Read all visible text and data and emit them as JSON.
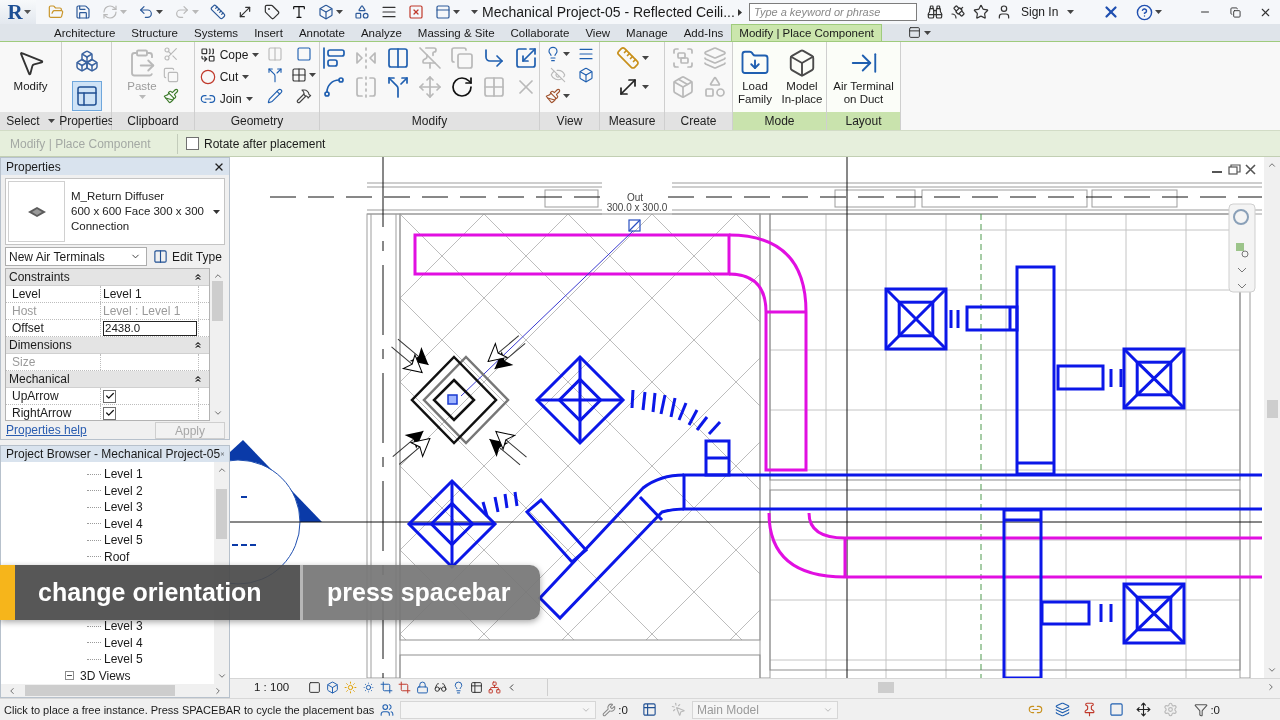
{
  "title_bar": {
    "app_logo": "R",
    "title": "Mechanical Project-05 - Reflected Ceili...",
    "search": {
      "placeholder": "Type a keyword or phrase"
    },
    "sign_in": "Sign In"
  },
  "quick_access": [
    {
      "disabled": false
    },
    {
      "disabled": false
    },
    {
      "disabled": true
    },
    {
      "disabled": false
    },
    {
      "disabled": true
    },
    {
      "disabled": false
    },
    {
      "disabled": false
    },
    {
      "disabled": false
    },
    {
      "disabled": false
    },
    {
      "disabled": false
    },
    {
      "disabled": false
    },
    {
      "disabled": false
    },
    {
      "disabled": false
    },
    {
      "disabled": false
    }
  ],
  "ribbon_tabs": [
    {
      "label": "Architecture",
      "selected": false
    },
    {
      "label": "Structure",
      "selected": false
    },
    {
      "label": "Systems",
      "selected": false
    },
    {
      "label": "Insert",
      "selected": false
    },
    {
      "label": "Annotate",
      "selected": false
    },
    {
      "label": "Analyze",
      "selected": false
    },
    {
      "label": "Massing & Site",
      "selected": false
    },
    {
      "label": "Collaborate",
      "selected": false
    },
    {
      "label": "View",
      "selected": false
    },
    {
      "label": "Manage",
      "selected": false
    },
    {
      "label": "Add-Ins",
      "selected": false
    },
    {
      "label": "Modify | Place Component",
      "selected": true
    }
  ],
  "ribbon_panels": [
    {
      "title": "Select",
      "has_menu": true,
      "contextual": false,
      "tools": [
        {
          "kind": "large",
          "label": "Modify",
          "disabled": false
        }
      ]
    },
    {
      "title": "Properties",
      "has_menu": false,
      "contextual": false,
      "tools": [
        {
          "kind": "icon",
          "disabled": false,
          "selected": false
        },
        {
          "kind": "icon",
          "disabled": false,
          "selected": true
        }
      ]
    },
    {
      "title": "Clipboard",
      "has_menu": false,
      "contextual": false,
      "tools": [
        {
          "kind": "large",
          "label": "Paste",
          "disabled": true,
          "menu": true
        },
        {
          "kind": "icon",
          "disabled": true
        },
        {
          "kind": "icon",
          "disabled": true
        },
        {
          "kind": "icon",
          "disabled": false
        }
      ]
    },
    {
      "title": "Geometry",
      "has_menu": false,
      "contextual": false,
      "tools": [
        {
          "kind": "small",
          "label": "Cope",
          "disabled": false,
          "menu": true
        },
        {
          "kind": "small",
          "label": "Cut",
          "disabled": false,
          "menu": true
        },
        {
          "kind": "small",
          "label": "Join",
          "disabled": false,
          "menu": true
        },
        {
          "kind": "icon",
          "disabled": true
        },
        {
          "kind": "icon",
          "disabled": false
        },
        {
          "kind": "icon",
          "disabled": false
        },
        {
          "kind": "icon",
          "disabled": false
        },
        {
          "kind": "icon",
          "disabled": false,
          "menu": true
        },
        {
          "kind": "icon",
          "disabled": false
        }
      ]
    },
    {
      "title": "Modify",
      "has_menu": false,
      "contextual": false,
      "tools": [
        {
          "kind": "icon",
          "disabled": false
        },
        {
          "kind": "icon",
          "disabled": false
        },
        {
          "kind": "icon",
          "disabled": true
        },
        {
          "kind": "icon",
          "disabled": true
        },
        {
          "kind": "icon",
          "disabled": false
        },
        {
          "kind": "icon",
          "disabled": false
        },
        {
          "kind": "icon",
          "disabled": true
        },
        {
          "kind": "icon",
          "disabled": true
        },
        {
          "kind": "icon",
          "disabled": true
        },
        {
          "kind": "icon",
          "disabled": false
        },
        {
          "kind": "icon",
          "disabled": false
        },
        {
          "kind": "icon",
          "disabled": true
        },
        {
          "kind": "icon",
          "disabled": false
        },
        {
          "kind": "icon",
          "disabled": true
        }
      ]
    },
    {
      "title": "View",
      "has_menu": false,
      "contextual": false,
      "tools": [
        {
          "kind": "icon",
          "disabled": false,
          "menu": true
        },
        {
          "kind": "icon",
          "disabled": true
        },
        {
          "kind": "icon",
          "disabled": false,
          "menu": true
        },
        {
          "kind": "icon",
          "disabled": false
        },
        {
          "kind": "icon",
          "disabled": false
        }
      ]
    },
    {
      "title": "Measure",
      "has_menu": false,
      "contextual": false,
      "tools": [
        {
          "kind": "icon",
          "disabled": false,
          "menu": true
        },
        {
          "kind": "icon",
          "disabled": false,
          "menu": true
        }
      ]
    },
    {
      "title": "Create",
      "has_menu": false,
      "contextual": false,
      "tools": [
        {
          "kind": "icon",
          "disabled": true
        },
        {
          "kind": "icon",
          "disabled": true
        },
        {
          "kind": "icon",
          "disabled": true
        },
        {
          "kind": "icon",
          "disabled": true
        }
      ]
    },
    {
      "title": "Mode",
      "has_menu": false,
      "contextual": true,
      "tools": [
        {
          "kind": "large",
          "label": "Load Family",
          "disabled": false
        },
        {
          "kind": "large",
          "label": "Model In-place",
          "disabled": false
        }
      ]
    },
    {
      "title": "Layout",
      "has_menu": false,
      "contextual": true,
      "tools": [
        {
          "kind": "large",
          "label": "Air Terminal on Duct",
          "disabled": false
        }
      ]
    }
  ],
  "options_bar": {
    "context": "Modify | Place Component",
    "rotate_after_placement": {
      "label": "Rotate after placement",
      "checked": false
    }
  },
  "properties": {
    "title": "Properties",
    "type": {
      "family": "M_Return Diffuser",
      "type_name": "600 x 600 Face 300 x 300 Connection"
    },
    "instance_filter": "New Air Terminals",
    "edit_type": "Edit Type",
    "groups": [
      {
        "label": "Constraints",
        "expanded": true,
        "rows": [
          {
            "name": "Level",
            "value": "Level 1",
            "kind": "text",
            "disabled": false
          },
          {
            "name": "Host",
            "value": "Level : Level 1",
            "kind": "text",
            "disabled": true
          },
          {
            "name": "Offset",
            "value": "2438.0",
            "kind": "input",
            "disabled": false
          }
        ]
      },
      {
        "label": "Dimensions",
        "expanded": true,
        "rows": [
          {
            "name": "Size",
            "kind": "text",
            "disabled": true
          }
        ]
      },
      {
        "label": "Mechanical",
        "expanded": true,
        "rows": [
          {
            "name": "UpArrow",
            "kind": "checkbox",
            "checked": true,
            "disabled": false
          },
          {
            "name": "RightArrow",
            "kind": "checkbox",
            "checked": true,
            "disabled": false
          }
        ]
      }
    ],
    "help_link": "Properties help",
    "apply": {
      "label": "Apply",
      "disabled": true
    }
  },
  "project_browser": {
    "title": "Project Browser - Mechanical Project-05",
    "tree": [
      {
        "children": [
          {
            "label": "Level 1"
          },
          {
            "label": "Level 2"
          },
          {
            "label": "Level 3"
          },
          {
            "label": "Level 4"
          },
          {
            "label": "Level 5"
          },
          {
            "label": "Roof"
          }
        ]
      },
      {
        "children": [
          {
            "label": "Level 3"
          },
          {
            "label": "Level 4"
          },
          {
            "label": "Level 5"
          }
        ]
      },
      {
        "label": "3D Views",
        "expanded": true
      }
    ]
  },
  "canvas": {
    "tag_label": "Out",
    "tag_size": "300.0 x 300.0"
  },
  "view_control_bar": {
    "scale": "1 : 100"
  },
  "status_bar": {
    "message": "Click to place a free instance. Press SPACEBAR to cycle the placement bas",
    "workset": {
      "disabled": true
    },
    "editing_requests": ":0",
    "option_tools": [
      {
        "disabled": false
      },
      {
        "disabled": true
      }
    ],
    "design_option": {
      "value": "Main Model",
      "disabled": true
    },
    "selection_filters": [
      {
        "disabled": false
      },
      {
        "disabled": false
      },
      {
        "disabled": false
      },
      {
        "disabled": false
      },
      {
        "disabled": false
      },
      {
        "disabled": true
      }
    ],
    "filter_count": ":0"
  },
  "caption": {
    "action": "change orientation",
    "key": "press spacebar"
  }
}
